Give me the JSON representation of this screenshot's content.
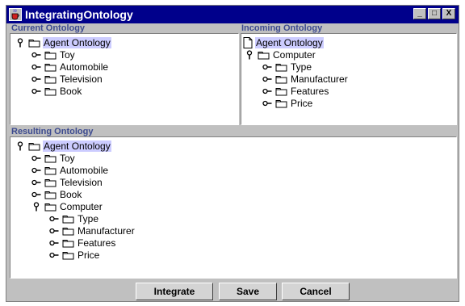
{
  "window": {
    "title": "IntegratingOntology",
    "controls": {
      "minimize": "_",
      "maximize": "□",
      "close": "X"
    }
  },
  "current_ontology": {
    "label": "Current Ontology",
    "root": "Agent Ontology",
    "children": [
      "Toy",
      "Automobile",
      "Television",
      "Book"
    ]
  },
  "incoming_ontology": {
    "label": "Incoming Ontology",
    "root": "Agent Ontology",
    "node": "Computer",
    "children": [
      "Type",
      "Manufacturer",
      "Features",
      "Price"
    ]
  },
  "resulting_ontology": {
    "label": "Resulting Ontology",
    "root": "Agent Ontology",
    "children": [
      "Toy",
      "Automobile",
      "Television",
      "Book"
    ],
    "node": "Computer",
    "subchildren": [
      "Type",
      "Manufacturer",
      "Features",
      "Price"
    ]
  },
  "buttons": {
    "integrate": "Integrate",
    "save": "Save",
    "cancel": "Cancel"
  },
  "colors": {
    "title_bar": "#00008b",
    "panel_label": "#3c4a8f",
    "selection": "#ccccff",
    "window_background": "#c0c0c0"
  },
  "icons": {
    "expanded_handle": "pushpin-expanded-icon",
    "collapsed_handle": "key-collapsed-icon",
    "folder": "folder-icon",
    "document": "document-icon"
  }
}
